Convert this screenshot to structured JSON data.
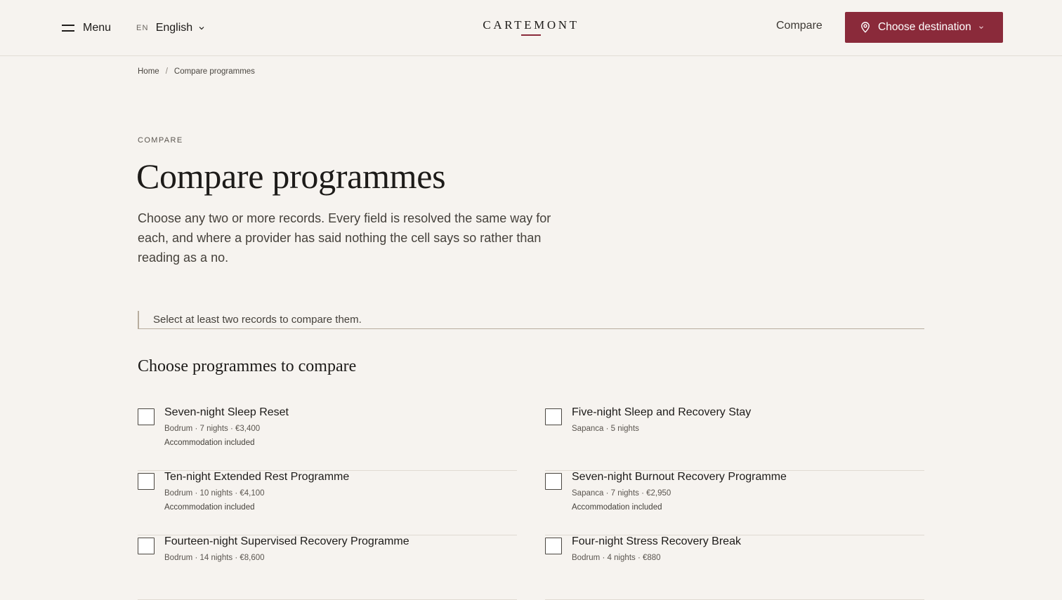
{
  "header": {
    "menu_label": "Menu",
    "lang_code": "EN",
    "lang_name": "English",
    "logo": "CARTEMONT",
    "compare_label": "Compare",
    "destination_label": "Choose destination",
    "accent_color": "#8a2a3a"
  },
  "breadcrumb": {
    "home": "Home",
    "separator": "/",
    "current": "Compare programmes"
  },
  "hero": {
    "eyebrow": "COMPARE",
    "title": "Compare programmes",
    "lead": "Choose any two or more records. Every field is resolved the same way for each, and where a provider has said nothing the cell says so rather than reading as a no."
  },
  "notice": "Select at least two records to compare them.",
  "section_title": "Choose programmes to compare",
  "programmes": [
    {
      "name": "Seven-night Sleep Reset",
      "meta": "Bodrum · 7 nights · €3,400",
      "extra": "Accommodation included",
      "checked": false
    },
    {
      "name": "Five-night Sleep and Recovery Stay",
      "meta": "Sapanca · 5 nights",
      "extra": "",
      "checked": false
    },
    {
      "name": "Ten-night Extended Rest Programme",
      "meta": "Bodrum · 10 nights · €4,100",
      "extra": "Accommodation included",
      "checked": false
    },
    {
      "name": "Seven-night Burnout Recovery Programme",
      "meta": "Sapanca · 7 nights · €2,950",
      "extra": "Accommodation included",
      "checked": false
    },
    {
      "name": "Fourteen-night Supervised Recovery Programme",
      "meta": "Bodrum · 14 nights · €8,600",
      "extra": "",
      "checked": false
    },
    {
      "name": "Four-night Stress Recovery Break",
      "meta": "Bodrum · 4 nights · €880",
      "extra": "",
      "checked": false
    }
  ]
}
